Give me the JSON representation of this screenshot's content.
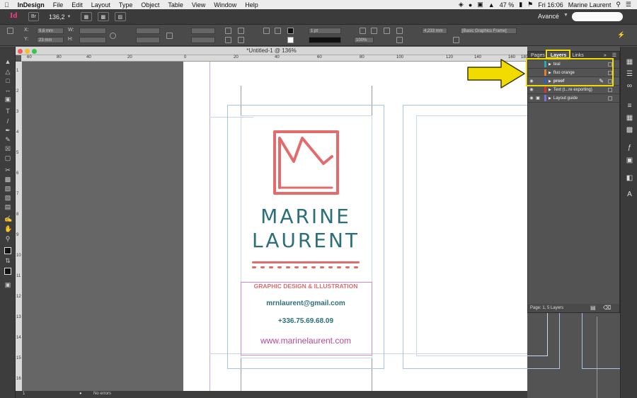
{
  "menubar": {
    "items": [
      "InDesign",
      "File",
      "Edit",
      "Layout",
      "Type",
      "Object",
      "Table",
      "View",
      "Window",
      "Help"
    ],
    "battery": "47 %",
    "clock": "Fri 16:06",
    "user": "Marine Laurent"
  },
  "appbar": {
    "logo": "Id",
    "bridge_label": "Br",
    "zoom": "136,2",
    "workspace": "Avancé"
  },
  "control": {
    "x_label": "X:",
    "y_label": "Y:",
    "x_value": "9,6 mm",
    "y_value": "23 mm",
    "stroke_weight": "1 pt",
    "percent": "100%",
    "measure": "4,233 mm",
    "frame_style": "[Basic Graphics Frame]"
  },
  "document": {
    "title": "*Untitled-1 @ 136%"
  },
  "ruler": {
    "h_ticks": [
      "60",
      "80",
      "40",
      "20",
      "0",
      "20",
      "40",
      "60",
      "80",
      "100",
      "120",
      "140",
      "160",
      "180"
    ],
    "v_ticks": [
      "1",
      "2",
      "3",
      "4",
      "5",
      "6",
      "7",
      "8",
      "9",
      "10",
      "11",
      "12",
      "13",
      "14",
      "15",
      "16"
    ]
  },
  "card": {
    "name_line1": "MARINE",
    "name_line2": "LAURENT",
    "tagline": "GRAPHIC DESIGN & ILLUSTRATION",
    "email": "mrnlaurent@gmail.com",
    "phone": "+336.75.69.68.09",
    "website": "www.marinelaurent.com",
    "brand_red": "#e36b6b",
    "brand_teal": "#2b6f7b",
    "brand_purple": "#b9489c"
  },
  "layers_panel": {
    "tabs": [
      "Pages",
      "Layers",
      "Links"
    ],
    "active_tab": "Layers",
    "layers": [
      {
        "name": "teal",
        "color": "#2aa6b5",
        "visible": false,
        "locked": false,
        "selected": false
      },
      {
        "name": "fluo orange",
        "color": "#e87a2c",
        "visible": false,
        "locked": false,
        "selected": false
      },
      {
        "name": "proof",
        "color": "#2f5fbf",
        "visible": true,
        "locked": false,
        "selected": true
      },
      {
        "name": "Text (t...re exporting)",
        "color": "#d9342b",
        "visible": true,
        "locked": false,
        "selected": false
      },
      {
        "name": "Layout guide",
        "color": "#7a6fd6",
        "visible": true,
        "locked": true,
        "selected": false
      }
    ],
    "status": "Page: 1, 5 Layers"
  },
  "callout": {
    "highlight_color": "#f2dc00"
  },
  "statusbar": {
    "page": "1",
    "errors": "No errors"
  }
}
